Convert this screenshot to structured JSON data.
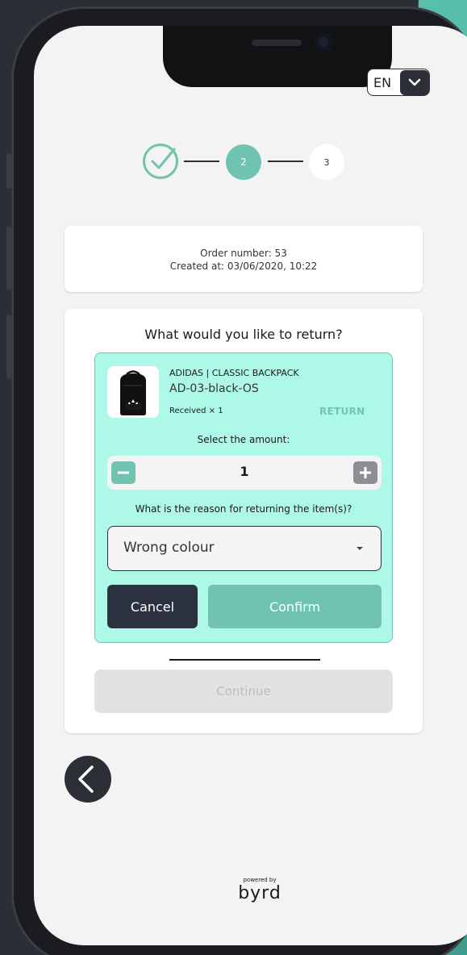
{
  "language": {
    "code": "EN"
  },
  "stepper": {
    "step2": "2",
    "step3": "3"
  },
  "order": {
    "number_text": "Order number: 53",
    "created_text": "Created at: 03/06/2020, 10:22"
  },
  "return_section": {
    "title": "What would you like to return?",
    "item": {
      "brand_name": "ADIDAS | CLASSIC BACKPACK",
      "sku": "AD-03-black-OS",
      "received": "Received × 1",
      "return_label": "RETURN"
    },
    "amount_label": "Select the amount:",
    "quantity": "1",
    "reason_question": "What is the reason for returning the item(s)?",
    "reason_selected": "Wrong colour",
    "cancel_label": "Cancel",
    "confirm_label": "Confirm",
    "continue_label": "Continue"
  },
  "footer": {
    "powered_by": "powered by",
    "brand": "byrd"
  },
  "colors": {
    "accent": "#6fc3b0",
    "panel_bg": "#aef8e8",
    "dark": "#2c3140",
    "disabled": "#e2e2e2"
  }
}
